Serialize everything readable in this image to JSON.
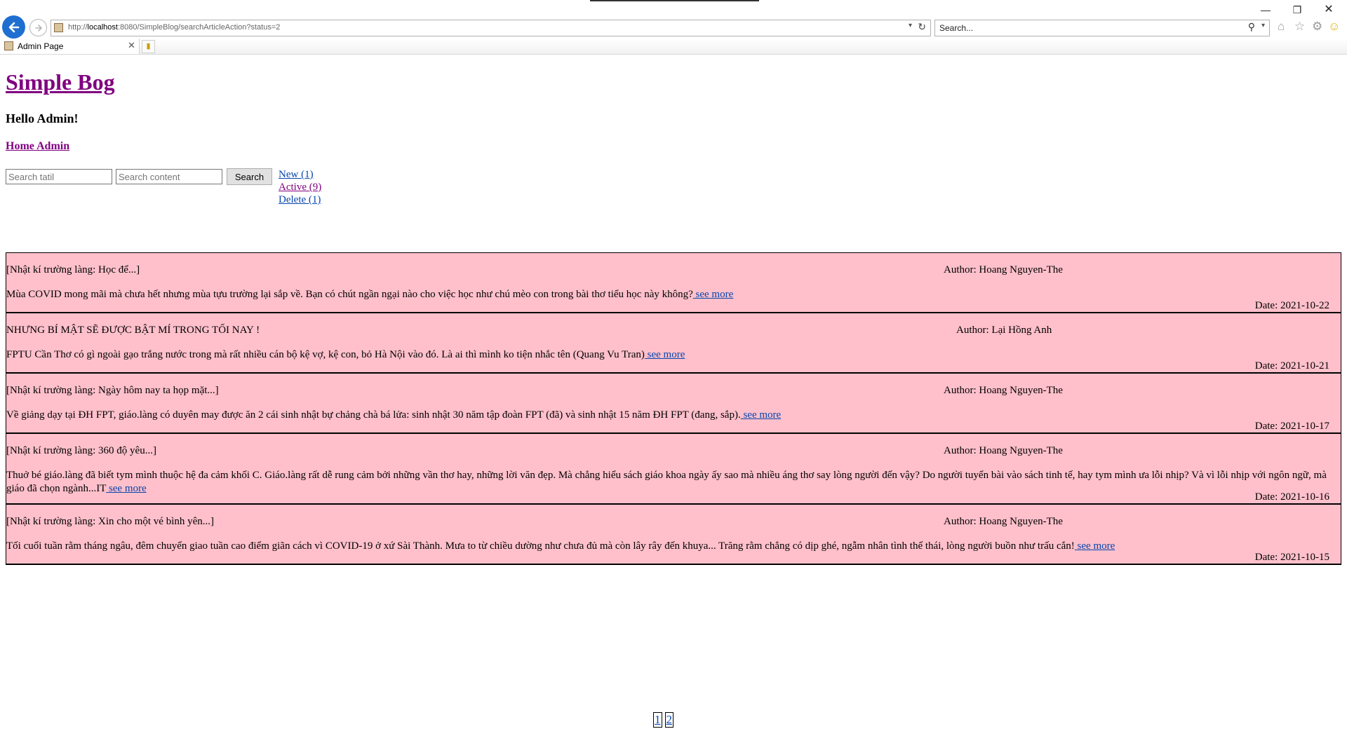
{
  "browser": {
    "url_prefix": "http://",
    "url_host": "localhost",
    "url_rest": ":8080/SimpleBlog/searchArticleAction?status=2",
    "search_placeholder": "Search...",
    "tab_title": "Admin Page",
    "icons": [
      "back-icon",
      "forward-icon",
      "refresh-icon",
      "search-icon",
      "home-icon",
      "star-icon",
      "gear-icon",
      "smiley-icon",
      "minimize-icon",
      "restore-icon",
      "close-icon"
    ]
  },
  "page": {
    "site_title": "Simple Bog",
    "greeting": "Hello Admin!",
    "home_link": "Home Admin"
  },
  "search": {
    "title_placeholder": "Search tatil",
    "content_placeholder": "Search content",
    "button_label": "Search"
  },
  "status_links": [
    {
      "label": "New (1)"
    },
    {
      "label": "Active (9)"
    },
    {
      "label": "Delete (1)"
    }
  ],
  "articles": [
    {
      "title": "[Nhật kí trường làng: Học để...]",
      "author": "Author: Hoang Nguyen-The",
      "description": "Mùa COVID mong mãi mà chưa hết nhưng mùa tựu trường lại sắp về. Bạn có chút ngần ngại nào cho việc học như chú mèo con trong bài thơ tiểu học này không?",
      "see_more": " see more",
      "date": "Date: 2021-10-22"
    },
    {
      "title": "NHƯNG BÍ MẬT SẼ ĐƯỢC BẬT MÍ TRONG TỐI NAY !",
      "author": "Author: Lại Hồng Anh",
      "description": "FPTU Cần Thơ có gì ngoài gạo trắng nước trong mà rất nhiều cán bộ kệ vợ, kệ con, bỏ Hà Nội vào đó. Là ai thì mình ko tiện nhắc tên (Quang Vu Tran)",
      "see_more": " see more",
      "date": "Date: 2021-10-21"
    },
    {
      "title": "[Nhật kí trường làng: Ngày hôm nay ta họp mặt...]",
      "author": "Author: Hoang Nguyen-The",
      "description": "Về giảng dạy tại ĐH FPT, giáo.làng có duyên may được ăn 2 cái sinh nhật bự chảng chà bá lửa: sinh nhật 30 năm tập đoàn FPT (đã) và sinh nhật 15 năm ĐH FPT (đang, sắp).",
      "see_more": " see more",
      "date": "Date: 2021-10-17"
    },
    {
      "title": "[Nhật kí trường làng: 360 độ yêu...]",
      "author": "Author: Hoang Nguyen-The",
      "description": "Thuở bé giáo.làng đã biết tym mình thuộc hệ đa cảm khối C. Giáo.làng rất dễ rung cảm bởi những vần thơ hay, những lời văn đẹp. Mà chẳng hiểu sách giáo khoa ngày ấy sao mà nhiều áng thơ say lòng người đến vậy? Do người tuyển bài vào sách tinh tế, hay tym mình ưa lỗi nhịp? Và vì lỗi nhịp với ngôn ngữ, mà giáo đã chọn ngành...IT",
      "see_more": " see more",
      "date": "Date: 2021-10-16"
    },
    {
      "title": "[Nhật kí trường làng: Xin cho một vé bình yên...]",
      "author": "Author: Hoang Nguyen-The",
      "description": "Tối cuối tuần rằm tháng ngâu, đêm chuyển giao tuần cao điểm giãn cách vì COVID-19 ở xứ Sài Thành. Mưa to từ chiều dường như chưa đủ mà còn lây rây đến khuya... Trăng rằm chẳng có dịp ghé, ngẫm nhân tình thế thái, lòng người buồn như trấu cắn!",
      "see_more": " see more",
      "date": "Date: 2021-10-15"
    }
  ],
  "pagination": [
    "1",
    "2"
  ]
}
